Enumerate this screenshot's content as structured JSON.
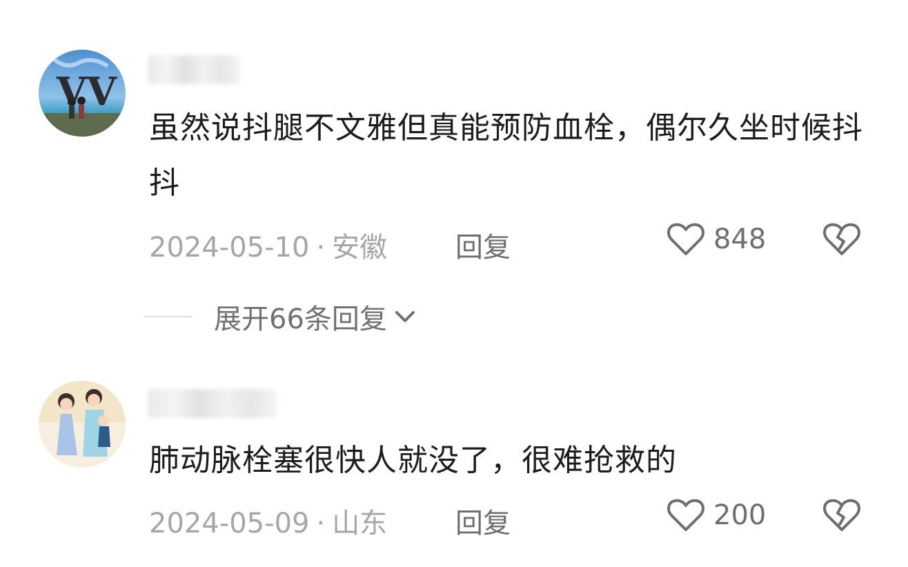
{
  "comments": [
    {
      "text": "虽然说抖腿不文雅但真能预防血栓，偶尔久坐时候抖抖",
      "date": "2024-05-10",
      "location": "安徽",
      "reply_label": "回复",
      "likes": "848",
      "replies_toggle": "展开66条回复"
    },
    {
      "text": "肺动脉栓塞很快人就没了，很难抢救的",
      "date": "2024-05-09",
      "location": "山东",
      "reply_label": "回复",
      "likes": "200"
    }
  ],
  "icons": {
    "like": "heart-outline-icon",
    "dislike": "broken-heart-icon",
    "expand": "chevron-down-icon"
  },
  "colors": {
    "text": "#1c1c1c",
    "meta": "#a6a6a6",
    "action": "#6e6e6e"
  }
}
